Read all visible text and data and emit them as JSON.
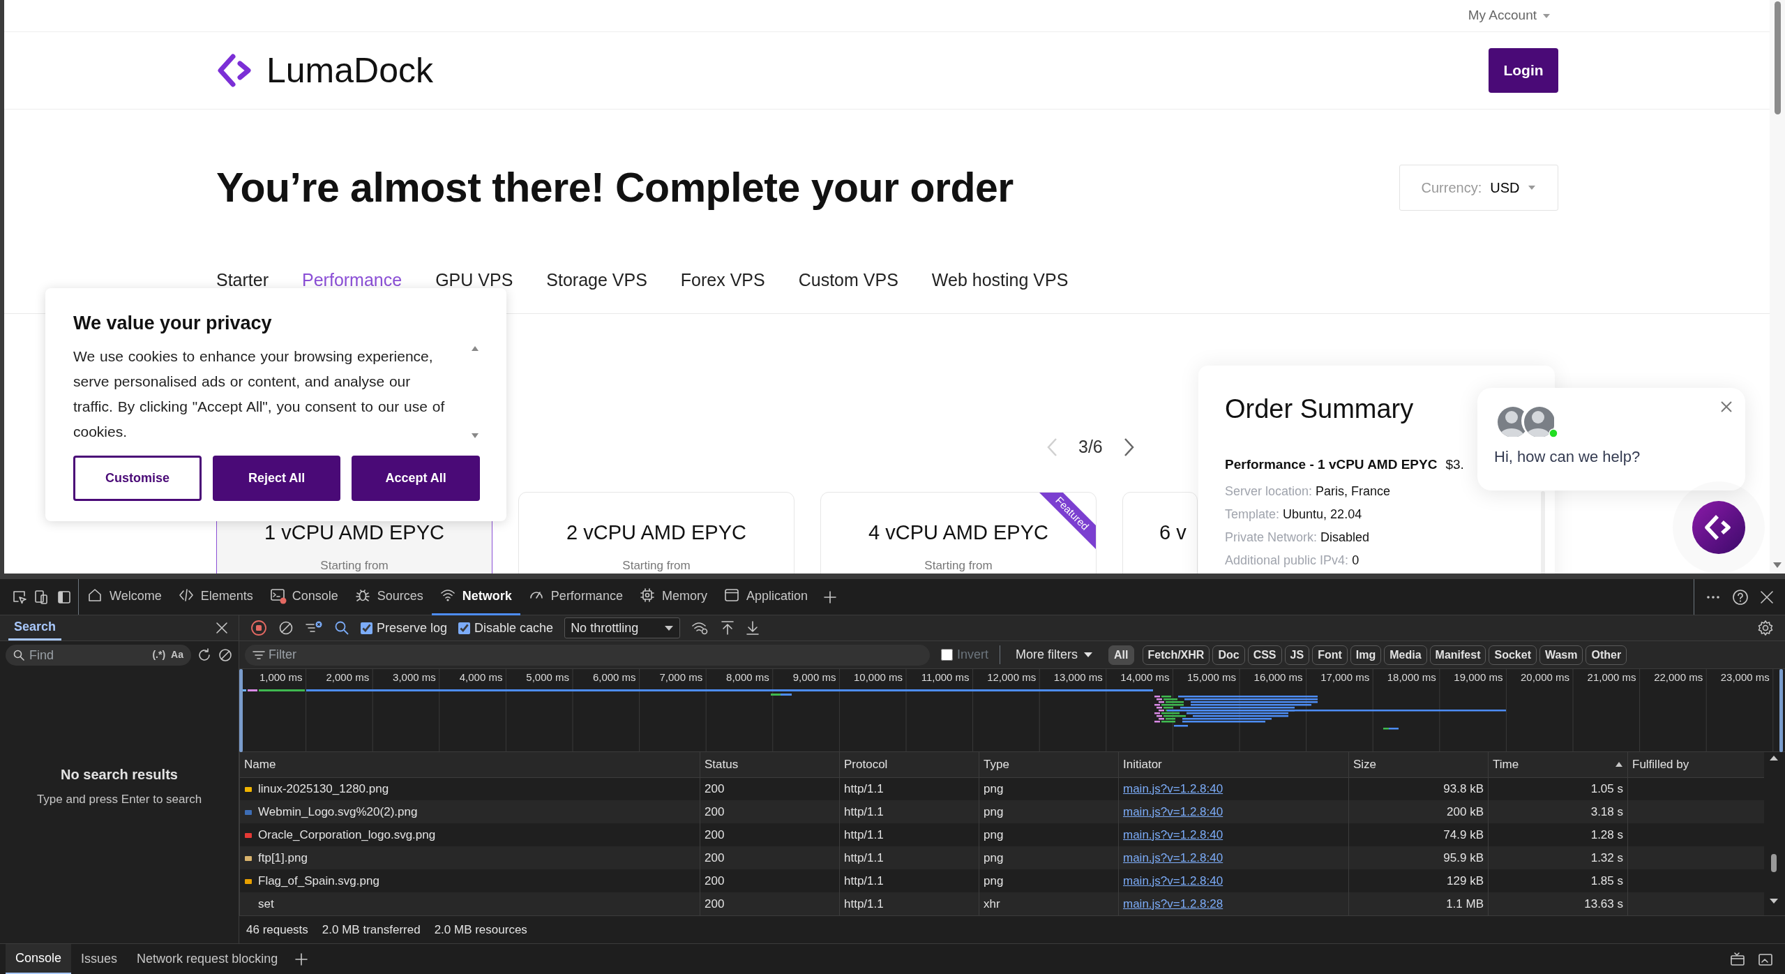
{
  "browser_page": {
    "account_menu": "My Account",
    "logo_text": "LumaDock",
    "login_button": "Login",
    "heading": "You’re almost there! Complete your order",
    "currency": {
      "label": "Currency:",
      "value": "USD"
    },
    "categories": [
      {
        "label": "Starter",
        "selected": false
      },
      {
        "label": "Performance",
        "selected": true
      },
      {
        "label": "GPU VPS",
        "selected": false
      },
      {
        "label": "Storage VPS",
        "selected": false
      },
      {
        "label": "Forex VPS",
        "selected": false
      },
      {
        "label": "Custom VPS",
        "selected": false
      },
      {
        "label": "Web hosting VPS",
        "selected": false
      }
    ],
    "pager": {
      "label": "3/6",
      "previous_disabled": true
    },
    "plans": [
      {
        "title": "1 vCPU AMD EPYC",
        "subtitle": "Starting from",
        "selected": true
      },
      {
        "title": "2 vCPU AMD EPYC",
        "subtitle": "Starting from",
        "selected": false
      },
      {
        "title": "4 vCPU AMD EPYC",
        "subtitle": "Starting from",
        "selected": false,
        "ribbon": "Featured"
      },
      {
        "title": "6 v",
        "selected": false
      }
    ],
    "order_summary": {
      "title": "Order Summary",
      "item": "Performance - 1 vCPU AMD EPYC",
      "price": "$3.",
      "details": [
        {
          "label": "Server location:",
          "value": "Paris, France"
        },
        {
          "label": "Template:",
          "value": "Ubuntu, 22.04"
        },
        {
          "label": "Private Network:",
          "value": "Disabled"
        },
        {
          "label": "Additional public IPv4:",
          "value": "0"
        }
      ]
    },
    "cookie_banner": {
      "title": "We value your privacy",
      "text": "We use cookies to enhance your browsing experience, serve personalised ads or content, and analyse our traffic. By clicking \"Accept All\", you consent to our use of cookies.",
      "buttons": [
        {
          "label": "Customise",
          "kind": "outline"
        },
        {
          "label": "Reject All",
          "kind": "filled"
        },
        {
          "label": "Accept All",
          "kind": "filled"
        }
      ]
    },
    "chat": {
      "message": "Hi, how can we help?",
      "agent_online": true
    }
  },
  "devtools": {
    "tabs": [
      {
        "label": "Welcome",
        "selected": false,
        "error_badge": false
      },
      {
        "label": "Elements",
        "selected": false,
        "error_badge": false
      },
      {
        "label": "Console",
        "selected": false,
        "error_badge": true
      },
      {
        "label": "Sources",
        "selected": false,
        "error_badge": false
      },
      {
        "label": "Network",
        "selected": true,
        "error_badge": false
      },
      {
        "label": "Performance",
        "selected": false,
        "error_badge": false
      },
      {
        "label": "Memory",
        "selected": false,
        "error_badge": false
      },
      {
        "label": "Application",
        "selected": false,
        "error_badge": false
      }
    ],
    "search_panel": {
      "tab": "Search",
      "find_placeholder": "Find",
      "regex_toggle": "(.*)",
      "case_toggle": "Aa",
      "empty_title": "No search results",
      "empty_hint": "Type and press Enter to search"
    },
    "toolbar": {
      "recording": true,
      "preserve_log": {
        "label": "Preserve log",
        "checked": true
      },
      "disable_cache": {
        "label": "Disable cache",
        "checked": true
      },
      "throttling": "No throttling"
    },
    "filter_bar": {
      "placeholder": "Filter",
      "invert": {
        "label": "Invert",
        "checked": false
      },
      "more_filters": "More filters",
      "types": [
        {
          "label": "All",
          "selected": true
        },
        {
          "label": "Fetch/XHR",
          "selected": false
        },
        {
          "label": "Doc",
          "selected": false
        },
        {
          "label": "CSS",
          "selected": false
        },
        {
          "label": "JS",
          "selected": false
        },
        {
          "label": "Font",
          "selected": false
        },
        {
          "label": "Img",
          "selected": false
        },
        {
          "label": "Media",
          "selected": false
        },
        {
          "label": "Manifest",
          "selected": false
        },
        {
          "label": "Socket",
          "selected": false
        },
        {
          "label": "Wasm",
          "selected": false
        },
        {
          "label": "Other",
          "selected": false
        }
      ]
    },
    "waterfall": {
      "ticks": [
        "1,000 ms",
        "2,000 ms",
        "3,000 ms",
        "4,000 ms",
        "5,000 ms",
        "6,000 ms",
        "7,000 ms",
        "8,000 ms",
        "9,000 ms",
        "10,000 ms",
        "11,000 ms",
        "12,000 ms",
        "13,000 ms",
        "14,000 ms",
        "15,000 ms",
        "16,000 ms",
        "17,000 ms",
        "18,000 ms",
        "19,000 ms",
        "20,000 ms",
        "21,000 ms",
        "22,000 ms",
        "23,000 ms"
      ]
    },
    "table": {
      "columns": [
        {
          "label": "Name",
          "sorted": false
        },
        {
          "label": "Status",
          "sorted": false
        },
        {
          "label": "Protocol",
          "sorted": false
        },
        {
          "label": "Type",
          "sorted": false
        },
        {
          "label": "Initiator",
          "sorted": false
        },
        {
          "label": "Size",
          "sorted": false
        },
        {
          "label": "Time",
          "sorted": true
        },
        {
          "label": "Fulfilled by",
          "sorted": false
        }
      ],
      "rows": [
        {
          "name": "linux-2025130_1280.png",
          "status": "200",
          "protocol": "http/1.1",
          "type": "png",
          "initiator": "main.js?v=1.2.8:40",
          "size": "93.8 kB",
          "time": "1.05 s",
          "color": "#f0b400"
        },
        {
          "name": "Webmin_Logo.svg%20(2).png",
          "status": "200",
          "protocol": "http/1.1",
          "type": "png",
          "initiator": "main.js?v=1.2.8:40",
          "size": "200 kB",
          "time": "3.18 s",
          "color": "#3d6db5"
        },
        {
          "name": "Oracle_Corporation_logo.svg.png",
          "status": "200",
          "protocol": "http/1.1",
          "type": "png",
          "initiator": "main.js?v=1.2.8:40",
          "size": "74.9 kB",
          "time": "1.28 s",
          "color": "#e53935"
        },
        {
          "name": "ftp[1].png",
          "status": "200",
          "protocol": "http/1.1",
          "type": "png",
          "initiator": "main.js?v=1.2.8:40",
          "size": "95.9 kB",
          "time": "1.32 s",
          "color": "#d9b36c"
        },
        {
          "name": "Flag_of_Spain.svg.png",
          "status": "200",
          "protocol": "http/1.1",
          "type": "png",
          "initiator": "main.js?v=1.2.8:40",
          "size": "129 kB",
          "time": "1.85 s",
          "color": "#e8a000"
        },
        {
          "name": "set",
          "status": "200",
          "protocol": "http/1.1",
          "type": "xhr",
          "initiator": "main.js?v=1.2.8:28",
          "size": "1.1 MB",
          "time": "13.63 s"
        }
      ]
    },
    "summary": [
      "46 requests",
      "2.0 MB transferred",
      "2.0 MB resources"
    ],
    "drawer_tabs": [
      {
        "label": "Console",
        "selected": true
      },
      {
        "label": "Issues",
        "selected": false
      },
      {
        "label": "Network request blocking",
        "selected": false
      }
    ]
  }
}
